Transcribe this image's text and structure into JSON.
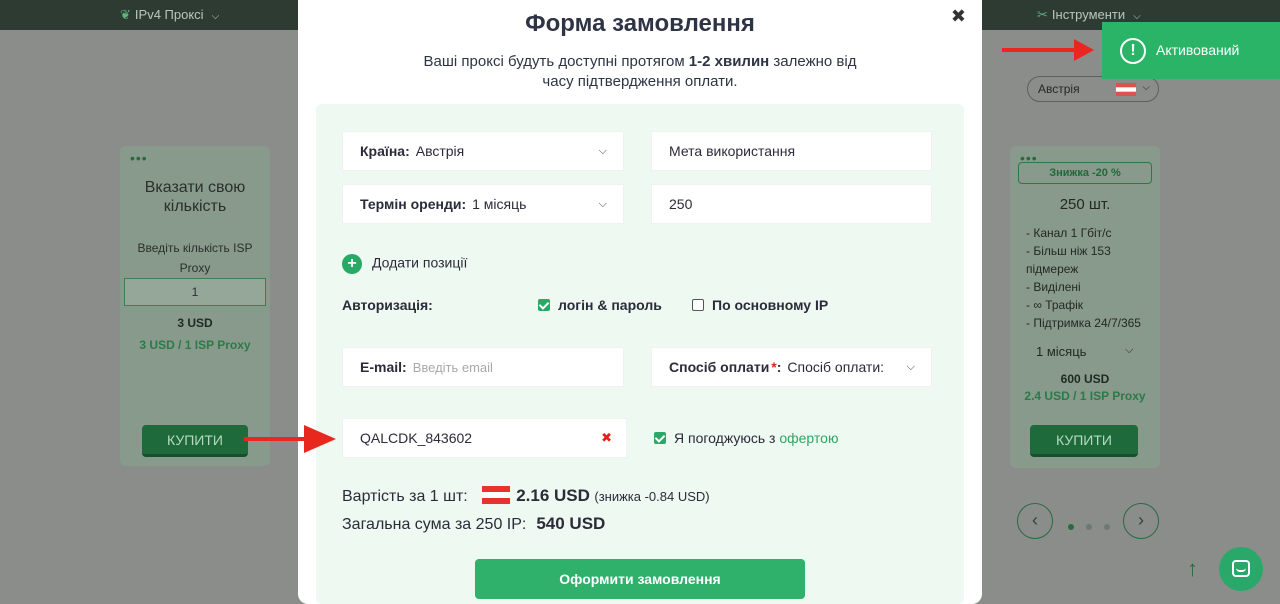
{
  "topbar": {
    "nav_proxies": "IPv4 Проксі",
    "nav_tools": "Інструменти"
  },
  "background": {
    "custom_card": {
      "title": "Вказати свою кількість",
      "qty_label": "Введіть кількість ISP Proxy",
      "qty_value": "1",
      "price": "3 USD",
      "price_per": "3 USD / 1 ISP Proxy",
      "buy": "КУПИТИ"
    },
    "package_card": {
      "discount": "Знижка -20 %",
      "pcs": "250 шт.",
      "features": [
        "- Канал 1 Гбіт/с",
        "- Більш ніж 153 підмереж",
        "- Виділені",
        "- ∞ Трафік",
        "- Підтримка 24/7/365"
      ],
      "period": "1 місяць",
      "price": "600 USD",
      "price_per": "2.4 USD / 1 ISP Proxy",
      "buy": "КУПИТИ"
    },
    "country_select": "Австрія"
  },
  "toast": {
    "label": "Активований"
  },
  "modal": {
    "title": "Форма замовлення",
    "lead_pre": "Ваші проксі будуть доступні протягом ",
    "lead_bold": "1-2 хвилин",
    "lead_post": " залежно від часу підтвердження оплати.",
    "country_label": "Країна:",
    "country_value": "Австрія",
    "purpose_value": "Мета використання",
    "term_label": "Термін оренди:",
    "term_value": "1 місяць",
    "quantity_value": "250",
    "add_position": "Додати позиції",
    "auth_label": "Авторизація:",
    "auth_login": "логін & пароль",
    "auth_ip": "По основному IP",
    "email_label": "E-mail:",
    "email_placeholder": "Введіть email",
    "payment_label": "Спосіб оплати",
    "payment_required": "*",
    "payment_value": "Спосіб оплати:",
    "promo_value": "QALCDK_843602",
    "agree_text": "Я погоджуюсь з ",
    "agree_link": "офертою",
    "cost_label": "Вартість за 1 шт:",
    "cost_value": "2.16 USD",
    "cost_discount": "(знижка -0.84 USD)",
    "total_label": "Загальна сума за 250 IP:",
    "total_value": "540 USD",
    "submit": "Оформити замовлення"
  },
  "colors": {
    "accent": "#2aa865",
    "annotation_arrow": "#e8281e"
  }
}
